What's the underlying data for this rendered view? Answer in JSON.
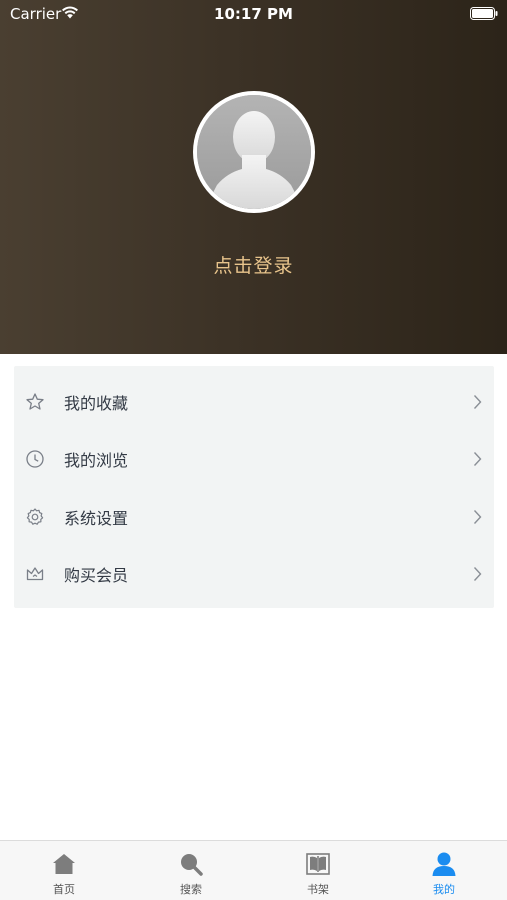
{
  "status_bar": {
    "carrier": "Carrier",
    "time": "10:17 PM"
  },
  "profile": {
    "login_label": "点击登录"
  },
  "menu": {
    "items": [
      {
        "label": "我的收藏",
        "icon": "star-icon"
      },
      {
        "label": "我的浏览",
        "icon": "clock-icon"
      },
      {
        "label": "系统设置",
        "icon": "gear-icon"
      },
      {
        "label": "购买会员",
        "icon": "crown-icon"
      }
    ]
  },
  "tab_bar": {
    "tabs": [
      {
        "label": "首页",
        "icon": "home-icon"
      },
      {
        "label": "搜索",
        "icon": "search-icon"
      },
      {
        "label": "书架",
        "icon": "book-icon"
      },
      {
        "label": "我的",
        "icon": "user-icon",
        "active": true
      }
    ]
  },
  "colors": {
    "header_gradient": [
      "#4a3f31",
      "#2c2419"
    ],
    "login_text": "#e8c48c",
    "menu_background": "#f2f4f4",
    "active_tab": "#1a8cf0"
  }
}
